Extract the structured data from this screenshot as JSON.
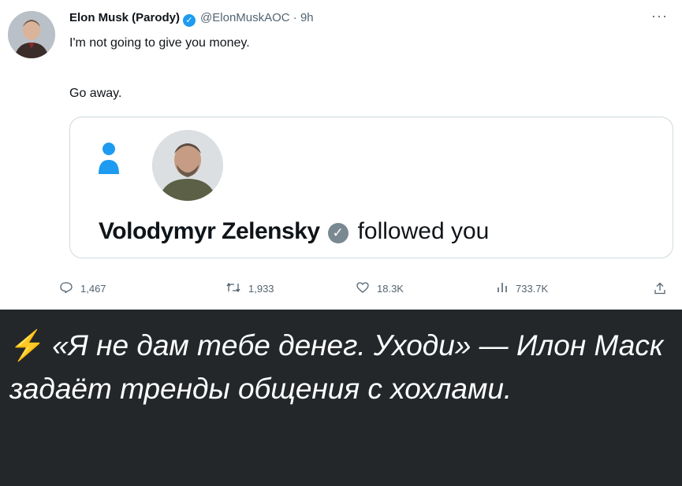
{
  "tweet": {
    "author_name": "Elon Musk (Parody)",
    "handle": "@ElonMuskAOC",
    "separator": "·",
    "time": "9h",
    "more_label": "···",
    "text_line1": "I'm not going to give you money.",
    "text_line2": "Go away.",
    "card": {
      "follower_name": "Volodymyr Zelensky",
      "follow_text": "followed you"
    },
    "actions": {
      "replies": "1,467",
      "retweets": "1,933",
      "likes": "18.3K",
      "views": "733.7K"
    }
  },
  "banner": {
    "emoji": "⚡",
    "text": "«Я не дам тебе денег. Уходи» — Илон Маск задаёт тренды общения с хохлами."
  },
  "colors": {
    "verified_blue": "#1d9bf0",
    "banner_bg": "#23272a",
    "bolt_yellow": "#ffcc00",
    "person_icon_blue": "#1d9bf0"
  }
}
